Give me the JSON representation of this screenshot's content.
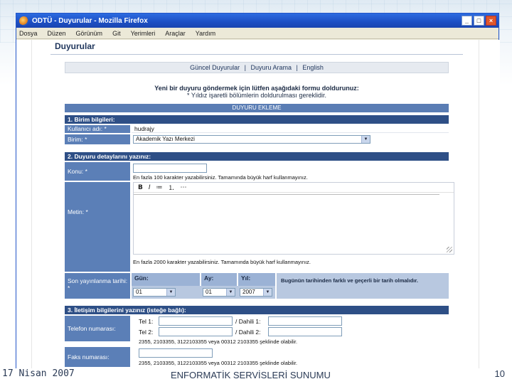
{
  "browser": {
    "title": "ODTÜ - Duyurular - Mozilla Firefox",
    "window_buttons": [
      "_",
      "□",
      "×"
    ],
    "menu": [
      "Dosya",
      "Düzen",
      "Görünüm",
      "Git",
      "Yerimleri",
      "Araçlar",
      "Yardım"
    ]
  },
  "page": {
    "title": "Duyurular",
    "nav": {
      "items": [
        "Güncel Duyurular",
        "Duyuru Arama",
        "English"
      ],
      "separator": "|"
    },
    "intro": {
      "line1": "Yeni bir duyuru göndermek için lütfen aşağıdaki formu doldurunuz:",
      "line2": "* Yıldız işaretli bölümlerin doldurulması gereklidir."
    },
    "form_header": "DUYURU EKLEME",
    "section1": {
      "title": "1. Birim bilgileri:",
      "username_label": "Kullanıcı adı: *",
      "username_value": "hudrajy",
      "unit_label": "Birim: *",
      "unit_value": "Akademik Yazı Merkezi"
    },
    "section2": {
      "title": "2. Duyuru detaylarını yazınız:",
      "subject_label": "Konu: *",
      "subject_value": "",
      "subject_hint": "En fazla 100 karakter yazabilirsiniz. Tamamında büyük harf kullanmayınız.",
      "body_label": "Metin: *",
      "toolbar": [
        "B",
        "I",
        "≔",
        "⒈",
        "⋯"
      ],
      "body_hint": "En fazla 2000 karakter yazabilirsiniz. Tamamında büyük harf kullanmayınız.",
      "date_label": "Son yayınlanma tarihi: *",
      "day_head": "Gün:",
      "month_head": "Ay:",
      "year_head": "Yıl:",
      "day_value": "01",
      "month_value": "01",
      "year_value": "2007",
      "date_note": "Bugünün tarihinden farklı ve geçerli bir tarih olmalıdır."
    },
    "section3": {
      "title": "3. İletişim bilgilerini yazınız (isteğe bağlı):",
      "phone_label": "Telefon numarası:",
      "tel1": "Tel 1:",
      "tel2": "Tel 2:",
      "dahili1": "/  Dahili 1:",
      "dahili2": "/  Dahili 2:",
      "phone_hint": "2355, 2103355, 3122103355 veya 00312 2103355 şeklinde olabilir.",
      "fax_label": "Faks numarası:",
      "fax_hint": "2355, 2103355, 3122103355 veya 00312 2103355 şeklinde olabilir."
    }
  },
  "footer": {
    "date": "17 Nisan 2007",
    "title": "ENFORMATİK SERVİSLERİ SUNUMU",
    "page_number": "10"
  }
}
